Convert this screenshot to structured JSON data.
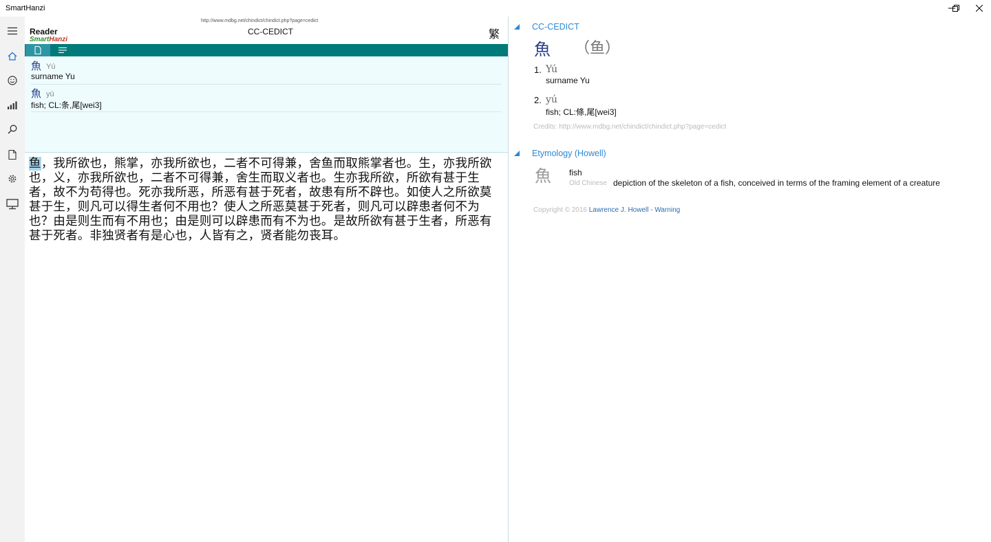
{
  "window": {
    "title": "SmartHanzi",
    "minimize_label": "–",
    "restore_label": "❐",
    "close_label": "✕"
  },
  "rail": {
    "items": [
      {
        "icon": "hamburger-menu-icon"
      },
      {
        "icon": "home-icon"
      },
      {
        "icon": "smiley-icon"
      },
      {
        "icon": "signal-bars-icon"
      },
      {
        "icon": "search-icon"
      },
      {
        "icon": "document-icon"
      },
      {
        "icon": "gear-icon"
      },
      {
        "icon": "monitor-icon"
      }
    ],
    "accent": "#1a73c9"
  },
  "reader": {
    "label": "Reader",
    "brand_part1": "Smart",
    "brand_part2": "Hanzi",
    "dict_url": "http://www.mdbg.net/chindict/chindict.php?page=cedict",
    "dict_name": "CC-CEDICT",
    "trad_toggle": "繁",
    "toolbar_color": "#017a7a",
    "results": [
      {
        "hanzi": "魚",
        "pinyin": "Yú",
        "definition": "surname Yu"
      },
      {
        "hanzi": "魚",
        "pinyin": "yú",
        "definition": "fish; CL:条,尾[wei3]"
      }
    ],
    "passage_highlight": "鱼",
    "passage_rest": "，我所欲也，熊掌，亦我所欲也，二者不可得兼，舍鱼而取熊掌者也。生，亦我所欲也，义，亦我所欲也，二者不可得兼，舍生而取义者也。生亦我所欲，所欲有甚于生者，故不为苟得也。死亦我所恶，所恶有甚于死者，故患有所不辟也。如使人之所欲莫甚于生，则凡可以得生者何不用也？使人之所恶莫甚于死者，则凡可以辟患者何不为也？由是则生而有不用也；由是则可以辟患而有不为也。是故所欲有甚于生者，所恶有甚于死者。非独贤者有是心也，人皆有之，贤者能勿丧耳。"
  },
  "details": {
    "accent": "#2b87d4",
    "cedict": {
      "header": "CC-CEDICT",
      "traditional": "魚",
      "simplified": "（鱼）",
      "senses": [
        {
          "num": "1.",
          "pinyin": "Yú",
          "definition": "surname Yu"
        },
        {
          "num": "2.",
          "pinyin": "yú",
          "definition": "fish; CL:條,尾[wei3]"
        }
      ],
      "credits": "Credits: http://www.mdbg.net/chindict/chindict.php?page=cedict"
    },
    "etymology": {
      "header": "Etymology (Howell)",
      "char": "魚",
      "gloss": "fish",
      "lang": "Old Chinese",
      "description": "depiction of the skeleton of a fish, conceived in terms of the framing element of a creature"
    },
    "copyright_prefix": "Copyright © 2016 ",
    "copyright_link": "Lawrence J. Howell - Warning"
  }
}
